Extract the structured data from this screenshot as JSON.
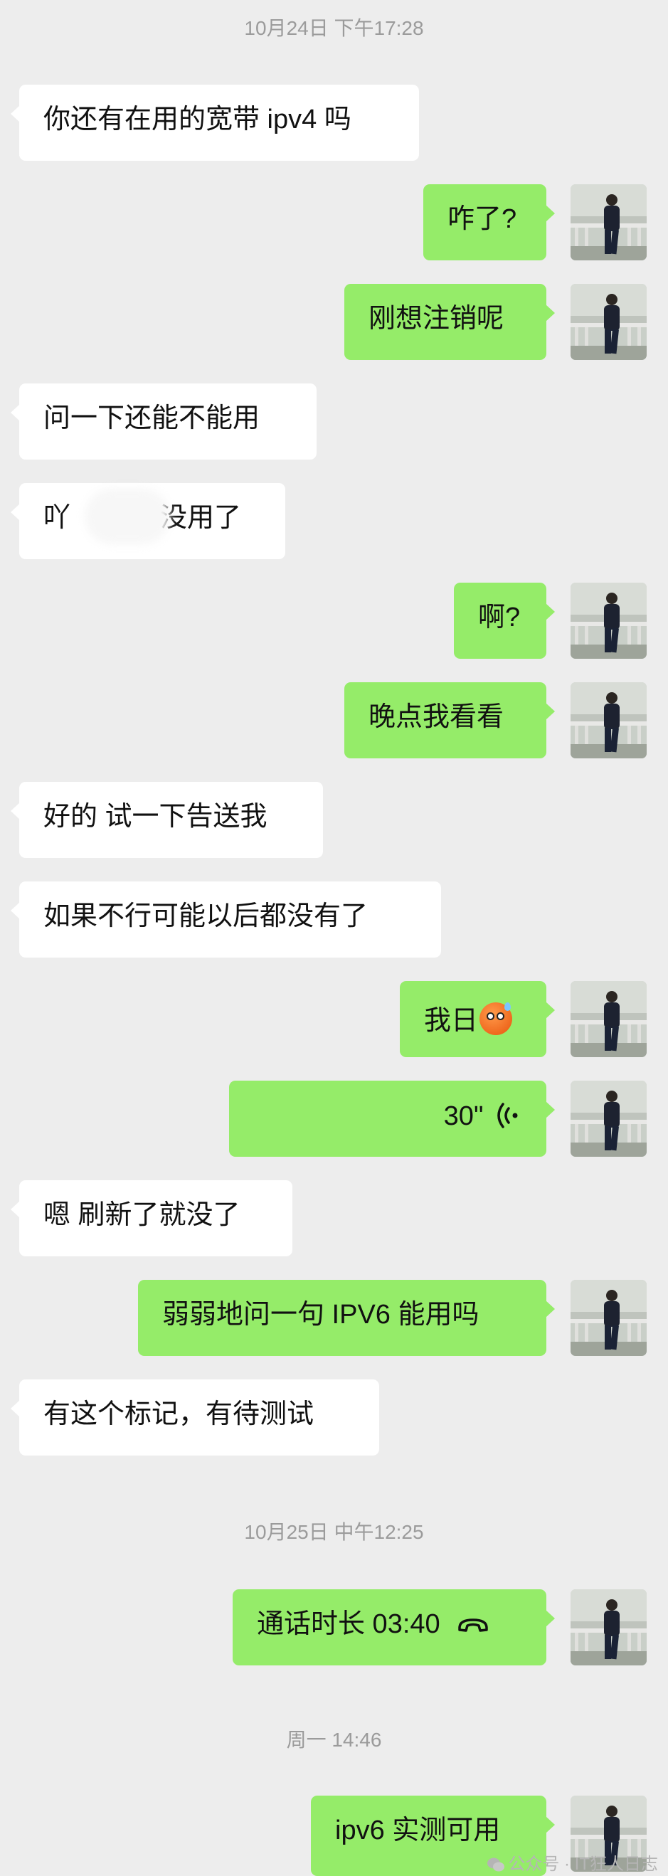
{
  "timestamps": {
    "t1": "10月24日 下午17:28",
    "t2": "10月25日 中午12:25",
    "t3": "周一 14:46"
  },
  "messages": {
    "m1": "你还有在用的宽带 ipv4 吗",
    "m2": "咋了?",
    "m3": "刚想注销呢",
    "m4": "问一下还能不能用",
    "m5a": "吖",
    "m5b": "没用了",
    "m6": "啊?",
    "m7": "晚点我看看",
    "m8": "好的 试一下告送我",
    "m9": "如果不行可能以后都没有了",
    "m10": "我日",
    "m11_duration": "30\"",
    "m12": "嗯 刷新了就没了",
    "m13": "弱弱地问一句 IPV6 能用吗",
    "m14": "有这个标记，有待测试",
    "m15": "通话时长 03:40",
    "m16": "ipv6 实测可用"
  },
  "icons": {
    "emoji": "dizzy-face-emoji",
    "voice": "voice-wave-icon",
    "call": "phone-hangup-icon",
    "wechat": "wechat-logo-icon"
  },
  "watermark": "公众号 · IT狂人日志",
  "colors": {
    "background": "#ededed",
    "incoming_bubble": "#ffffff",
    "outgoing_bubble": "#95ec69",
    "timestamp": "#9b9b9b"
  }
}
